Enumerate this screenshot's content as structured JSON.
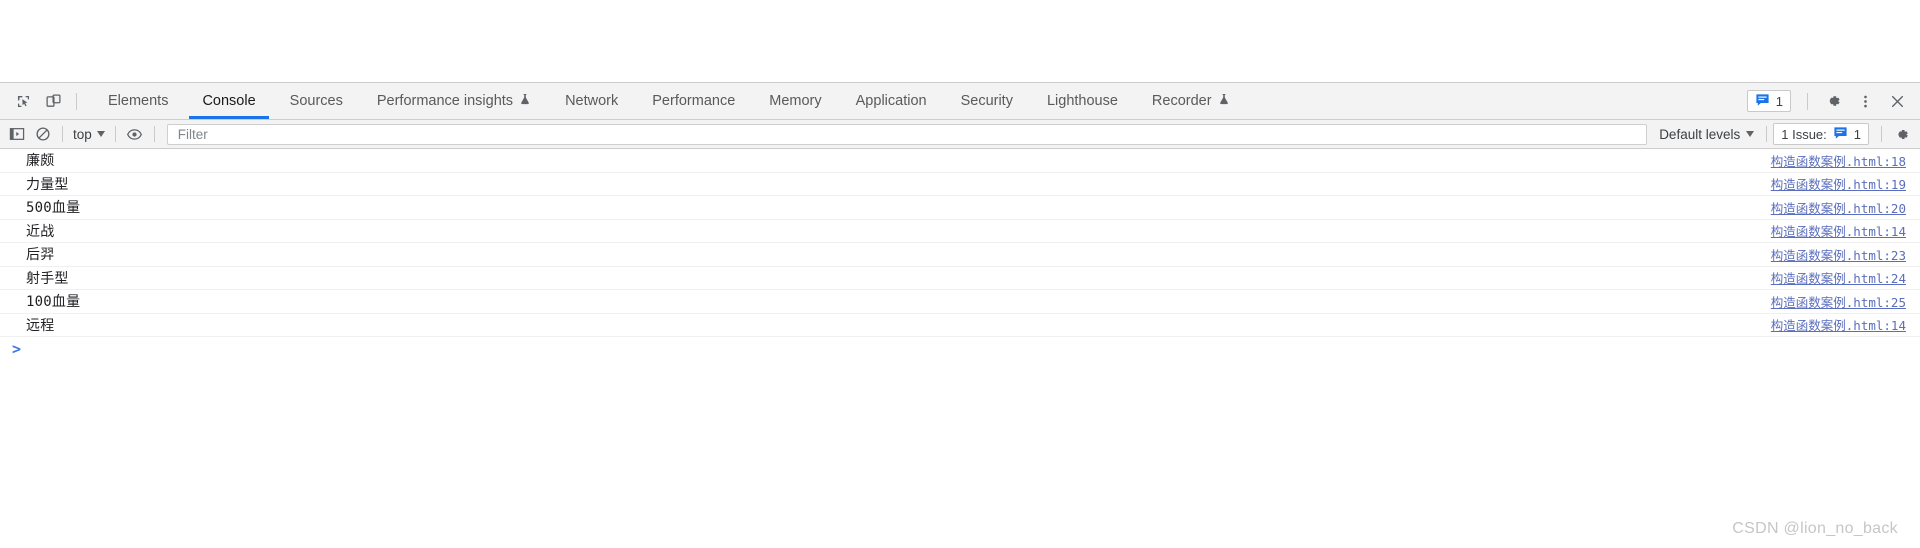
{
  "devtools": {
    "toolbar_icons": {
      "inspect": "inspect-element-icon",
      "device": "device-toolbar-icon"
    },
    "tabs": [
      {
        "label": "Elements",
        "selected": false,
        "experimental": false
      },
      {
        "label": "Console",
        "selected": true,
        "experimental": false
      },
      {
        "label": "Sources",
        "selected": false,
        "experimental": false
      },
      {
        "label": "Performance insights",
        "selected": false,
        "experimental": true
      },
      {
        "label": "Network",
        "selected": false,
        "experimental": false
      },
      {
        "label": "Performance",
        "selected": false,
        "experimental": false
      },
      {
        "label": "Memory",
        "selected": false,
        "experimental": false
      },
      {
        "label": "Application",
        "selected": false,
        "experimental": false
      },
      {
        "label": "Security",
        "selected": false,
        "experimental": false
      },
      {
        "label": "Lighthouse",
        "selected": false,
        "experimental": false
      },
      {
        "label": "Recorder",
        "selected": false,
        "experimental": true
      }
    ],
    "right_actions": {
      "issues_count": "1",
      "issues_icon": "issues-message-icon",
      "settings_icon": "gear-icon",
      "more_icon": "more-vertical-icon",
      "close_icon": "close-icon"
    }
  },
  "console_toolbar": {
    "sidebar_icon": "console-sidebar-icon",
    "clear_icon": "clear-console-icon",
    "context": "top",
    "eye_icon": "live-expression-eye-icon",
    "filter": {
      "value": "",
      "placeholder": "Filter"
    },
    "levels": "Default levels",
    "issue_label": "1 Issue:",
    "issue_count": "1",
    "issue_icon": "issues-message-icon",
    "settings_icon": "gear-icon"
  },
  "console_messages": [
    {
      "text": "廉颇",
      "source": "构造函数案例.html:18"
    },
    {
      "text": "力量型",
      "source": "构造函数案例.html:19"
    },
    {
      "text": "500血量",
      "source": "构造函数案例.html:20"
    },
    {
      "text": "近战",
      "source": "构造函数案例.html:14"
    },
    {
      "text": "后羿",
      "source": "构造函数案例.html:23"
    },
    {
      "text": "射手型",
      "source": "构造函数案例.html:24"
    },
    {
      "text": "100血量",
      "source": "构造函数案例.html:25"
    },
    {
      "text": "远程",
      "source": "构造函数案例.html:14"
    }
  ],
  "prompt": {
    "caret": ">",
    "value": ""
  },
  "watermark": "CSDN @lion_no_back",
  "colors": {
    "accent": "#1a73e8",
    "link": "#5a6ebd",
    "toolbar_bg": "#f3f3f3",
    "border": "#cdcdcd",
    "text": "#202124",
    "watermark": "#c6c6c6"
  }
}
